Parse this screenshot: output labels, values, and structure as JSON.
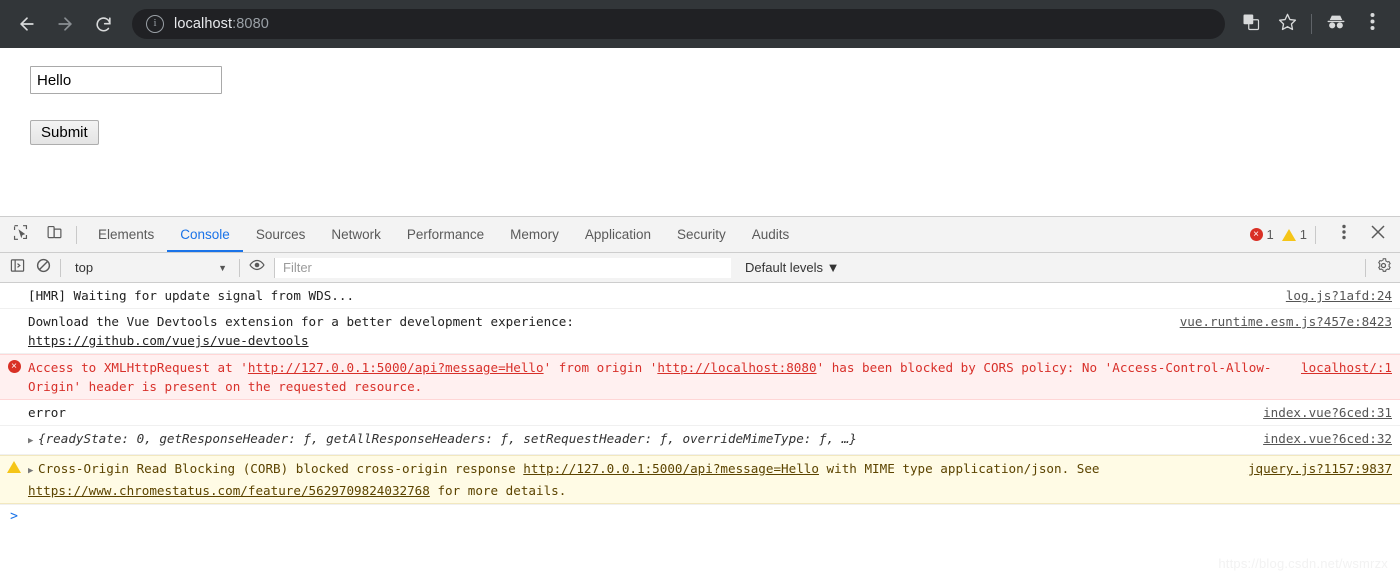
{
  "browser": {
    "back_icon": "back-arrow-icon",
    "forward_icon": "forward-arrow-icon",
    "reload_icon": "reload-icon",
    "site_info_icon": "info-circle-icon",
    "url_host": "localhost",
    "url_port": ":8080",
    "translate_icon": "translate-icon",
    "bookmark_icon": "star-icon",
    "incognito_icon": "incognito-icon",
    "menu_icon": "three-dot-menu-icon"
  },
  "page": {
    "input_value": "Hello",
    "input_placeholder": "",
    "submit_label": "Submit"
  },
  "devtools": {
    "inspect_icon": "inspect-element-icon",
    "device_toolbar_icon": "device-toolbar-icon",
    "tabs": [
      {
        "label": "Elements",
        "active": false
      },
      {
        "label": "Console",
        "active": true
      },
      {
        "label": "Sources",
        "active": false
      },
      {
        "label": "Network",
        "active": false
      },
      {
        "label": "Performance",
        "active": false
      },
      {
        "label": "Memory",
        "active": false
      },
      {
        "label": "Application",
        "active": false
      },
      {
        "label": "Security",
        "active": false
      },
      {
        "label": "Audits",
        "active": false
      }
    ],
    "error_count": "1",
    "warning_count": "1",
    "more_icon": "three-dot-menu-icon",
    "close_icon": "close-icon",
    "console_bar": {
      "sidebar_icon": "console-sidebar-icon",
      "clear_icon": "clear-console-icon",
      "context": "top",
      "context_caret": "▼",
      "eye_icon": "live-expression-icon",
      "filter_placeholder": "Filter",
      "filter_value": "",
      "levels_label": "Default levels ▼",
      "settings_icon": "gear-icon"
    },
    "messages": [
      {
        "type": "log",
        "text": "[HMR] Waiting for update signal from WDS...",
        "source": "log.js?1afd:24"
      },
      {
        "type": "log",
        "line1": "Download the Vue Devtools extension for a better development experience:",
        "line2": "https://github.com/vuejs/vue-devtools",
        "source": "vue.runtime.esm.js?457e:8423"
      },
      {
        "type": "error",
        "part1": "Access to XMLHttpRequest at '",
        "link1": "http://127.0.0.1:5000/api?message=Hello",
        "part2": "' from origin '",
        "link2": "http://localhost:8080",
        "part3": "' has been blocked by CORS policy: No 'Access-Control-Allow-Origin' header is present on the requested resource.",
        "source": "localhost/:1"
      },
      {
        "type": "log",
        "text": "error",
        "source": "index.vue?6ced:31"
      },
      {
        "type": "object",
        "text": "{readyState: 0, getResponseHeader: ƒ, getAllResponseHeaders: ƒ, setRequestHeader: ƒ, overrideMimeType: ƒ, …}",
        "source": "index.vue?6ced:32"
      },
      {
        "type": "warn",
        "part1": "Cross-Origin Read Blocking (CORB) blocked cross-origin response ",
        "link1": "http://127.0.0.1:5000/api?message=Hello",
        "part2": " with MIME type application/json. See ",
        "link2": "https://www.chromestatus.com/feature/5629709824032768",
        "part3": " for more details.",
        "source": "jquery.js?1157:9837"
      }
    ],
    "prompt_caret": ">"
  },
  "watermark": "https://blog.csdn.net/wsmrzx"
}
